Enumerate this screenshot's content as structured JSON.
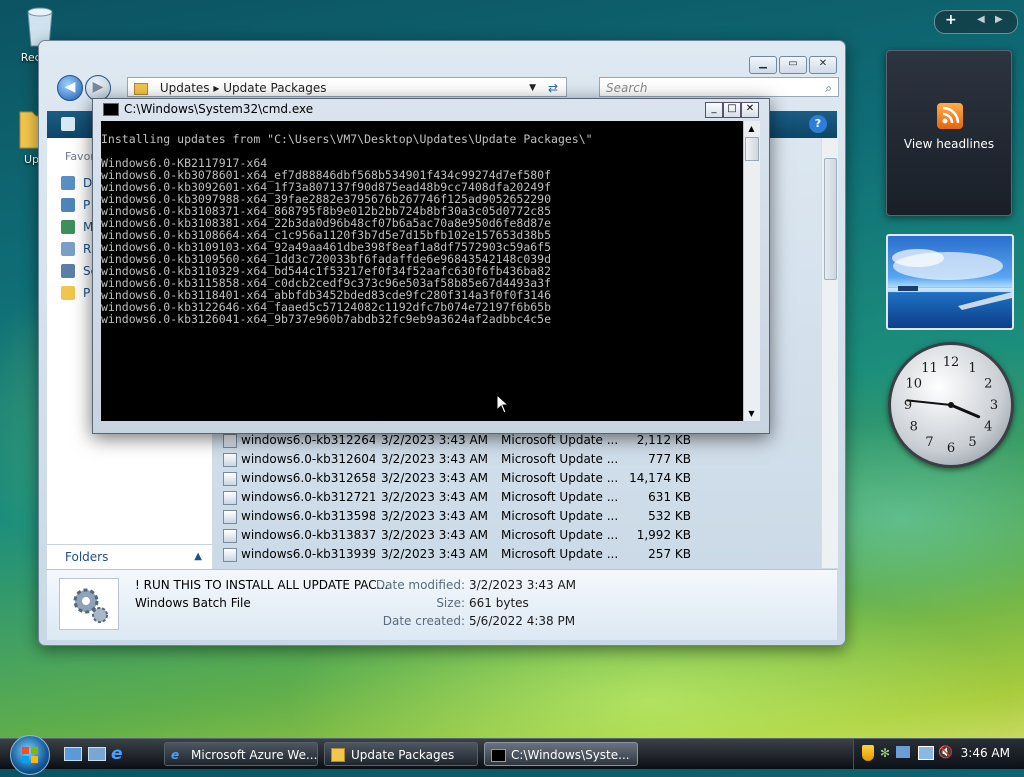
{
  "desktop": {
    "icons": [
      {
        "label": "Recyc"
      },
      {
        "label": "Upd"
      }
    ]
  },
  "explorer": {
    "breadcrumb": [
      "Updates",
      "Update Packages"
    ],
    "search_placeholder": "Search",
    "favorites_label": "Favor",
    "left_links": [
      "D",
      "P",
      "M",
      "R",
      "Se",
      "P"
    ],
    "folders_label": "Folders",
    "files": [
      {
        "name": "windows6.0-kb312264...",
        "date": "3/2/2023 3:43 AM",
        "type": "Microsoft Update ...",
        "size": "2,112 KB"
      },
      {
        "name": "windows6.0-kb312604...",
        "date": "3/2/2023 3:43 AM",
        "type": "Microsoft Update ...",
        "size": "777 KB"
      },
      {
        "name": "windows6.0-kb312658...",
        "date": "3/2/2023 3:43 AM",
        "type": "Microsoft Update ...",
        "size": "14,174 KB"
      },
      {
        "name": "windows6.0-kb312721...",
        "date": "3/2/2023 3:43 AM",
        "type": "Microsoft Update ...",
        "size": "631 KB"
      },
      {
        "name": "windows6.0-kb313598...",
        "date": "3/2/2023 3:43 AM",
        "type": "Microsoft Update ...",
        "size": "532 KB"
      },
      {
        "name": "windows6.0-kb313837...",
        "date": "3/2/2023 3:43 AM",
        "type": "Microsoft Update ...",
        "size": "1,992 KB"
      },
      {
        "name": "windows6.0-kb313939...",
        "date": "3/2/2023 3:43 AM",
        "type": "Microsoft Update ...",
        "size": "257 KB"
      }
    ],
    "details": {
      "name": "! RUN THIS TO INSTALL ALL UPDATE PAC...",
      "type": "Windows Batch File",
      "date_modified_label": "Date modified:",
      "date_modified": "3/2/2023 3:43 AM",
      "size_label": "Size:",
      "size": "661 bytes",
      "date_created_label": "Date created:",
      "date_created": "5/6/2022 4:38 PM"
    }
  },
  "cmd": {
    "title": "C:\\Windows\\System32\\cmd.exe",
    "lines": [
      "",
      "Installing updates from \"C:\\Users\\VM7\\Desktop\\Updates\\Update Packages\\\"",
      "",
      "Windows6.0-KB2117917-x64",
      "windows6.0-kb3078601-x64_ef7d88846dbf568b534901f434c99274d7ef580f",
      "windows6.0-kb3092601-x64_1f73a807137f90d875ead48b9cc7408dfa20249f",
      "windows6.0-kb3097988-x64_39fae2882e3795676b267746f125ad9052652290",
      "windows6.0-kb3108371-x64_868795f8b9e012b2bb724b8bf30a3c05d0772c85",
      "windows6.0-kb3108381-x64_22b3da0d96b48cf07b6a5ac70a8e950d6fe8d87e",
      "windows6.0-kb3108664-x64_c1c956a1120f3b7d5e7d15bfb102e157653d38b5",
      "windows6.0-kb3109103-x64_92a49aa461dbe398f8eaf1a8df7572903c59a6f5",
      "windows6.0-kb3109560-x64_1dd3c720033bf6fadaffde6e96843542148c039d",
      "windows6.0-kb3110329-x64_bd544c1f53217ef0f34f52aafc630f6fb436ba82",
      "windows6.0-kb3115858-x64_c0dcb2cedf9c373c96e503af58b85e67d4493a3f",
      "windows6.0-kb3118401-x64_abbfdb3452bded83cde9fc280f314a3f0f0f3146",
      "windows6.0-kb3122646-x64_faaed5c57124082c1192dfc7b074e72197f6b65b",
      "windows6.0-kb3126041-x64_9b737e960b7abdb32fc9eb9a3624af2adbbc4c5e"
    ]
  },
  "gadgets": {
    "rss_label": "View headlines",
    "clock_numbers": [
      "12",
      "1",
      "2",
      "3",
      "4",
      "5",
      "6",
      "7",
      "8",
      "9",
      "10",
      "11"
    ]
  },
  "taskbar": {
    "buttons": [
      {
        "label": "Microsoft Azure We..."
      },
      {
        "label": "Update Packages"
      },
      {
        "label": "C:\\Windows\\Syste..."
      }
    ],
    "time": "3:46 AM"
  }
}
